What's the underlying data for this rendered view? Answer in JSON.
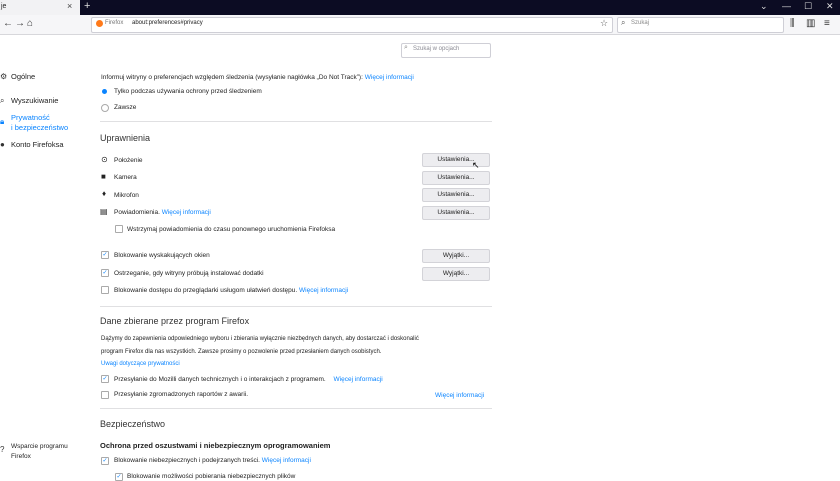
{
  "tab": {
    "title": "je",
    "close": "×"
  },
  "newtab": "+",
  "window": {
    "list": "⌄",
    "minimize": "—",
    "maximize": "☐",
    "close": "✕"
  },
  "nav": {
    "back": "←",
    "forward": "→",
    "reload": "↻",
    "home": "⌂",
    "library": "⫼",
    "sidebar": "▥",
    "menu": "≡"
  },
  "urlbar": {
    "identity": "Firefox",
    "url": "about:preferences#privacy",
    "star": "☆"
  },
  "searchbar": {
    "placeholder": "Szukaj"
  },
  "find": {
    "placeholder": "Szukaj w opcjach"
  },
  "sidebar": {
    "general": "Ogólne",
    "search": "Wyszukiwanie",
    "privacy": "Prywatność\ni bezpieczeństwo",
    "account": "Konto Firefoksa",
    "support": "Wsparcie programu\nFirefox"
  },
  "dnt": {
    "text": "Informuj witryny o preferencjach względem śledzenia (wysyłanie nagłówka „Do Not Track”):",
    "link": "Więcej informacji",
    "option1": "Tylko podczas używania ochrony przed śledzeniem",
    "option2": "Zawsze"
  },
  "permissions": {
    "heading": "Uprawnienia",
    "location": "Położenie",
    "camera": "Kamera",
    "microphone": "Mikrofon",
    "notifications": "Powiadomienia.",
    "notifications_link": "Więcej informacji",
    "pause": "Wstrzymaj powiadomienia do czasu ponownego uruchomienia Firefoksa",
    "settings_btn": "Ustawienia...",
    "popups": "Blokowanie wyskakujących okien",
    "addons": "Ostrzeganie, gdy witryny próbują instalować dodatki",
    "exceptions_btn": "Wyjątki...",
    "a11y": "Blokowanie dostępu do przeglądarki usługom ułatwień dostępu.",
    "a11y_link": "Więcej informacji"
  },
  "data_collection": {
    "heading": "Dane zbierane przez program Firefox",
    "desc1": "Dążymy do zapewnienia odpowiedniego wyboru i zbierania wyłącznie niezbędnych danych, aby dostarczać i doskonalić",
    "desc2": "program Firefox dla nas wszystkich. Zawsze prosimy o pozwolenie przed przesłaniem danych osobistych.",
    "privacy_link": "Uwagi dotyczące prywatności",
    "telemetry": "Przesyłanie do Mozilli danych technicznych i o interakcjach z programem.",
    "telemetry_link": "Więcej informacji",
    "crash": "Przesyłanie zgromadzonych raportów z awarii.",
    "crash_link": "Więcej informacji"
  },
  "security": {
    "heading": "Bezpieczeństwo",
    "subheading": "Ochrona przed oszustwami i niebezpiecznym oprogramowaniem",
    "block_dangerous": "Blokowanie niebezpiecznych i podejrzanych treści.",
    "block_link": "Więcej informacji",
    "block_downloads": "Blokowanie możliwości pobierania niebezpiecznych plików"
  },
  "check": "✓",
  "colors": {
    "accent": "#0a84ff",
    "tabstrip": "#0c0c23"
  }
}
